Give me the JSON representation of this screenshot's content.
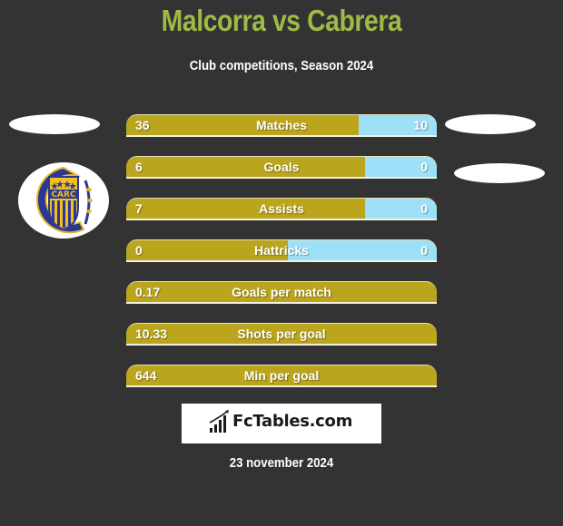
{
  "header": {
    "title": "Malcorra vs Cabrera",
    "subtitle": "Club competitions, Season 2024"
  },
  "colors": {
    "title": "#9dbb46",
    "left_bar": "#bba51c",
    "right_bar": "#9ee0f8",
    "background": "#333333"
  },
  "team_logo": {
    "icon": "rosario-central-crest-icon",
    "text": "CARC"
  },
  "stats": [
    {
      "label": "Matches",
      "left": "36",
      "right": "10",
      "left_share": 0.75
    },
    {
      "label": "Goals",
      "left": "6",
      "right": "0",
      "left_share": 0.77
    },
    {
      "label": "Assists",
      "left": "7",
      "right": "0",
      "left_share": 0.77
    },
    {
      "label": "Hattricks",
      "left": "0",
      "right": "0",
      "left_share": 0.52
    },
    {
      "label": "Goals per match",
      "left": "0.17",
      "right": null,
      "left_share": 1.0
    },
    {
      "label": "Shots per goal",
      "left": "10.33",
      "right": null,
      "left_share": 1.0
    },
    {
      "label": "Min per goal",
      "left": "644",
      "right": null,
      "left_share": 1.0
    }
  ],
  "brand": {
    "name": "FcTables.com",
    "icon": "bar-chart-icon"
  },
  "footer": {
    "date": "23 november 2024"
  }
}
